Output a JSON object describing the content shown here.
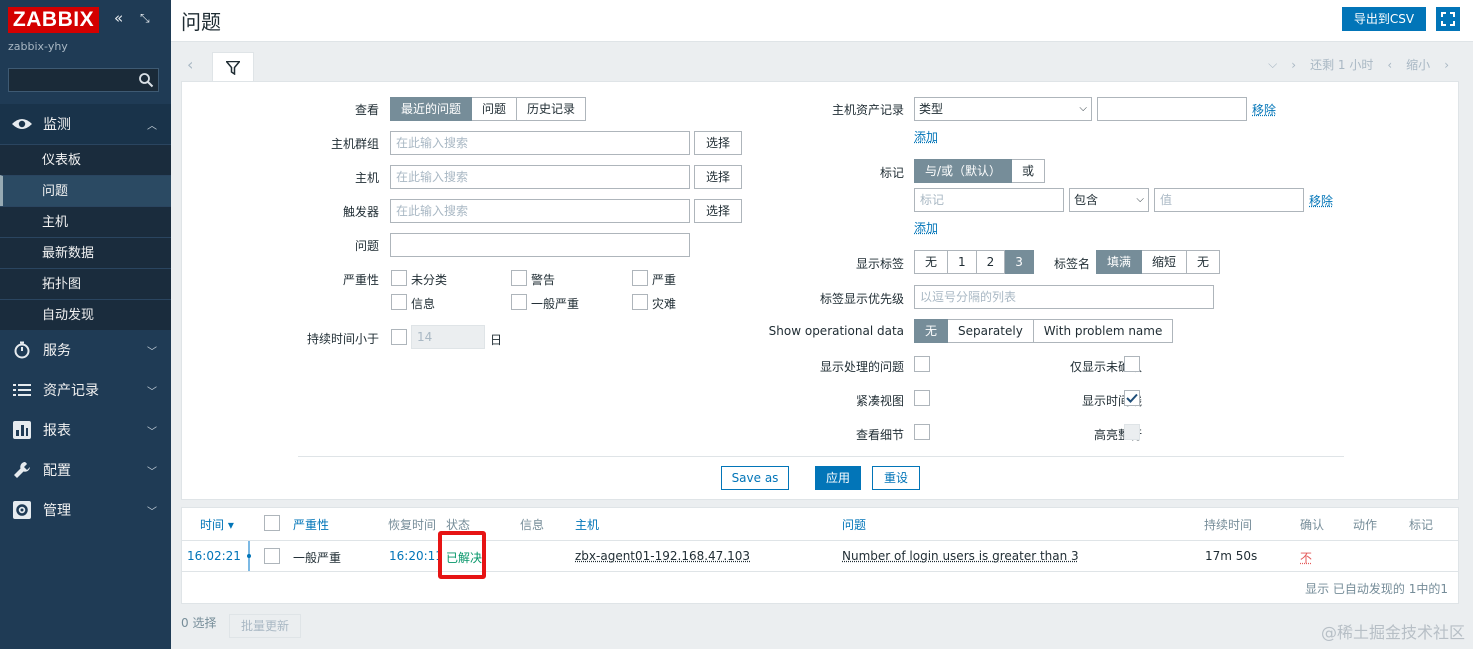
{
  "sidebar": {
    "logo": "ZABBIX",
    "server": "zabbix-yhy",
    "menu": [
      {
        "label": "监测",
        "icon": "eye-icon"
      },
      {
        "label": "服务",
        "icon": "stopwatch-icon"
      },
      {
        "label": "资产记录",
        "icon": "list-icon"
      },
      {
        "label": "报表",
        "icon": "bar-chart-icon"
      },
      {
        "label": "配置",
        "icon": "wrench-icon"
      },
      {
        "label": "管理",
        "icon": "gear-icon"
      }
    ],
    "submenu": [
      "仪表板",
      "问题",
      "主机",
      "最新数据",
      "拓扑图",
      "自动发现"
    ]
  },
  "header": {
    "title": "问题",
    "export_label": "导出到CSV"
  },
  "timenav": {
    "back": "还剩 1 小时",
    "zoom_out": "缩小"
  },
  "filter": {
    "view_label": "查看",
    "view_options": [
      "最近的问题",
      "问题",
      "历史记录"
    ],
    "hostgroup_label": "主机群组",
    "host_label": "主机",
    "trigger_label": "触发器",
    "problem_label": "问题",
    "severity_label": "严重性",
    "search_placeholder": "在此输入搜索",
    "select_label": "选择",
    "severities": [
      "未分类",
      "警告",
      "严重",
      "信息",
      "一般严重",
      "灾难"
    ],
    "age_label": "持续时间小于",
    "age_value": "14",
    "age_unit": "日",
    "inventory_label": "主机资产记录",
    "inventory_select": "类型",
    "remove_label": "移除",
    "add_label": "添加",
    "tags_label": "标记",
    "tags_eval": [
      "与/或（默认）",
      "或"
    ],
    "tag_placeholder": "标记",
    "tag_op": "包含",
    "value_placeholder": "值",
    "show_tags_label": "显示标签",
    "show_tags_options": [
      "无",
      "1",
      "2",
      "3"
    ],
    "tag_name_label": "标签名",
    "tag_name_options": [
      "填满",
      "缩短",
      "无"
    ],
    "tag_priority_label": "标签显示优先级",
    "tag_priority_placeholder": "以逗号分隔的列表",
    "opdata_label": "Show operational data",
    "opdata_options": [
      "无",
      "Separately",
      "With problem name"
    ],
    "show_suppressed_label": "显示处理的问题",
    "unack_label": "仅显示未确认",
    "compact_label": "紧凑视图",
    "timeline_label": "显示时间线",
    "details_label": "查看细节",
    "highlight_label": "高亮整行",
    "save_as": "Save as",
    "apply": "应用",
    "reset": "重设"
  },
  "table": {
    "headers": [
      "时间 ▾",
      "严重性",
      "恢复时间",
      "状态",
      "信息",
      "主机",
      "问题",
      "持续时间",
      "确认",
      "动作",
      "标记"
    ],
    "rows": [
      {
        "time": "16:02:21",
        "severity": "一般严重",
        "recovery": "16:20:11",
        "status": "已解决",
        "host": "zbx-agent01-192.168.47.103",
        "problem": "Number of login users is greater than 3",
        "duration": "17m 50s",
        "ack": "不"
      }
    ],
    "footer": "显示 已自动发现的 1中的1"
  },
  "bottom": {
    "selected": "0 选择",
    "mass_update": "批量更新"
  },
  "watermark": "@稀土掘金技术社区",
  "colors": {
    "sidebar": "#1f3b55",
    "accent": "#0275b8",
    "resolved": "#059669",
    "logo": "#d40000",
    "highlight_box": "#e61414"
  }
}
